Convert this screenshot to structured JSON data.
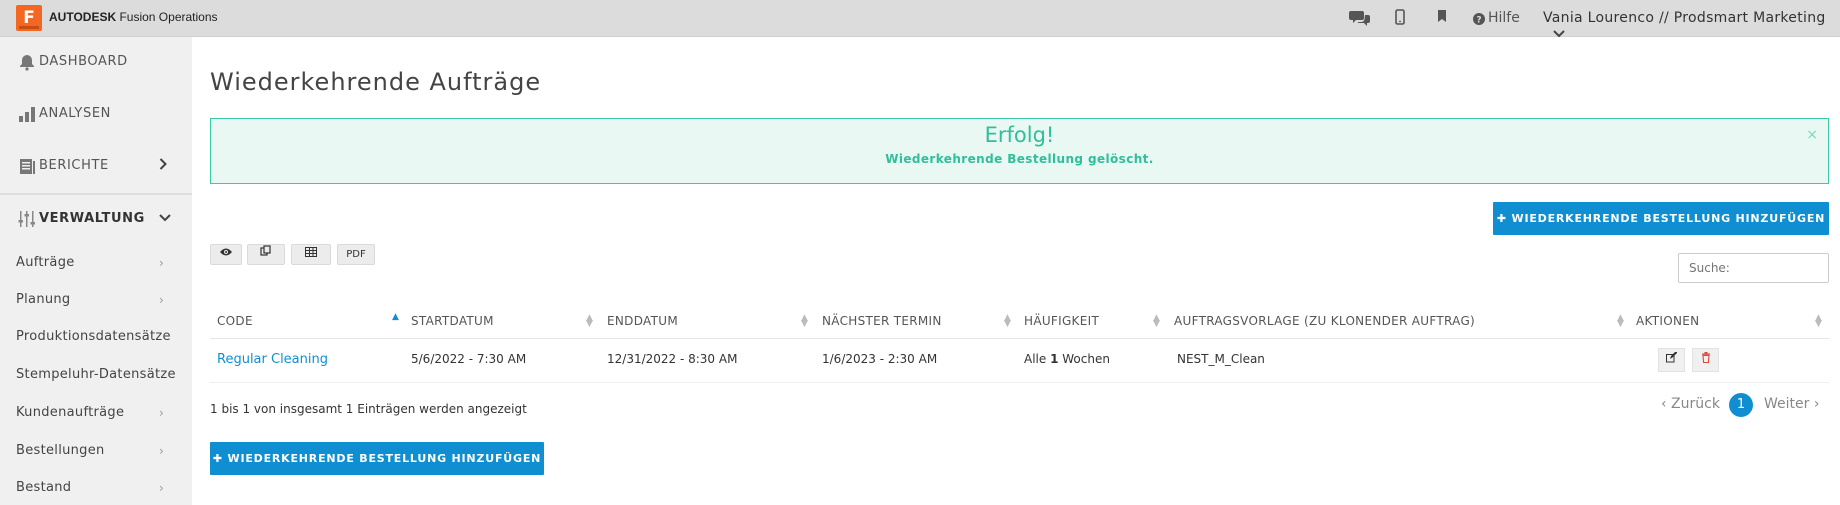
{
  "topbar": {
    "logo_letter": "F",
    "brand_bold": "AUTODESK",
    "brand_rest": " Fusion Operations",
    "icons": [
      "chat-icon",
      "mobile-icon",
      "bookmark-icon",
      "help-icon"
    ],
    "help_label": "Hilfe",
    "user_label": "Vania Lourenco // Prodsmart Marketing"
  },
  "sidebar": {
    "main": [
      {
        "label": "DASHBOARD",
        "icon": "bell-icon"
      },
      {
        "label": "ANALYSEN",
        "icon": "bar-chart-icon"
      },
      {
        "label": "BERICHTE",
        "icon": "document-icon"
      },
      {
        "label": "VERWALTUNG",
        "icon": "sliders-icon"
      }
    ],
    "sub": [
      {
        "label": "Aufträge"
      },
      {
        "label": "Planung"
      },
      {
        "label": "Produktionsdatensätze"
      },
      {
        "label": "Stempeluhr-Datensätze"
      },
      {
        "label": "Kundenaufträge"
      },
      {
        "label": "Bestellungen"
      },
      {
        "label": "Bestand"
      }
    ]
  },
  "main": {
    "title": "Wiederkehrende Aufträge",
    "alert": {
      "title": "Erfolg!",
      "message": "Wiederkehrende Bestellung gelöscht.",
      "close": "×"
    },
    "add_button": "✚ WIEDERKEHRENDE BESTELLUNG HINZUFÜGEN",
    "tools": {
      "view": "👁",
      "copy": "⧉",
      "table": "▦",
      "pdf": "PDF"
    },
    "search_placeholder": "Suche:",
    "table": {
      "headers": [
        "CODE",
        "STARTDATUM",
        "ENDDATUM",
        "NÄCHSTER TERMIN",
        "HÄUFIGKEIT",
        "AUFTRAGSVORLAGE (ZU KLONENDER AUFTRAG)",
        "AKTIONEN"
      ],
      "rows": [
        {
          "code": "Regular Cleaning",
          "start": "5/6/2022 - 7:30 AM",
          "end": "12/31/2022 - 8:30 AM",
          "next": "1/6/2023 - 2:30 AM",
          "freq_pre": "Alle ",
          "freq_num": "1",
          "freq_post": " Wochen",
          "template": "NEST_M_Clean"
        }
      ]
    },
    "info": "1 bis 1 von insgesamt 1 Einträgen werden angezeigt",
    "pagination": {
      "prev": "‹ Zurück",
      "page": "1",
      "next": "Weiter ›"
    }
  },
  "colors": {
    "accent": "#0f8fd2",
    "success": "#2fbf9b",
    "brand": "#f26722",
    "delete": "#e0453a"
  }
}
